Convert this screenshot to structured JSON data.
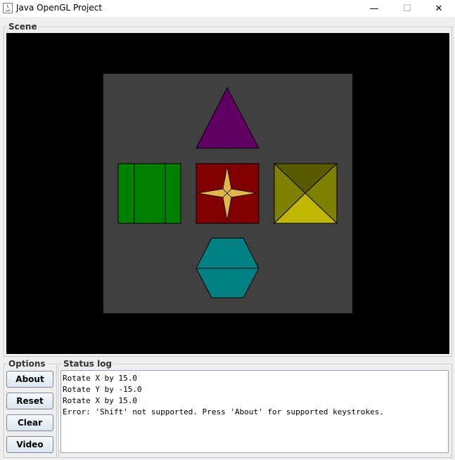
{
  "window": {
    "title": "Java OpenGL Project",
    "minimize_glyph": "—",
    "maximize_glyph": "☐",
    "close_glyph": "✕"
  },
  "scene": {
    "label": "Scene",
    "background": "#000000",
    "panel_color": "#404040",
    "shapes": [
      {
        "name": "triangle",
        "fill": "#610063"
      },
      {
        "name": "green-cube",
        "fill": "#008000"
      },
      {
        "name": "red-star-square",
        "fill": "#800000",
        "star_fill": "#e0b84a"
      },
      {
        "name": "olive-pyramid",
        "fill_top": "#5a5a00",
        "fill_side": "#808000",
        "fill_bottom": "#c0b800"
      },
      {
        "name": "teal-hexagon",
        "fill": "#008080"
      }
    ]
  },
  "options": {
    "label": "Options",
    "buttons": [
      "About",
      "Reset",
      "Clear",
      "Video"
    ]
  },
  "status": {
    "label": "Status log",
    "lines": [
      "Rotate X by 15.0",
      "Rotate Y by -15.0",
      "Rotate X by 15.0",
      "Error: 'Shift' not supported. Press 'About' for supported keystrokes."
    ]
  }
}
